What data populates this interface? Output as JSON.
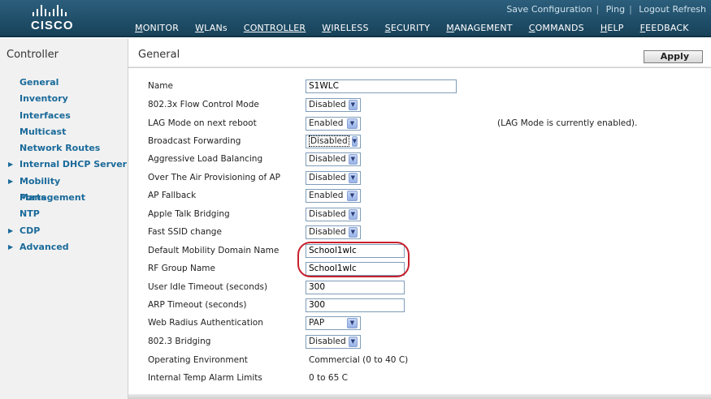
{
  "brand": {
    "name": "CISCO"
  },
  "utility_links": [
    "Save Configuration",
    "Ping",
    "Logout",
    "Refresh"
  ],
  "nav": [
    "MONITOR",
    "WLANs",
    "CONTROLLER",
    "WIRELESS",
    "SECURITY",
    "MANAGEMENT",
    "COMMANDS",
    "HELP",
    "FEEDBACK"
  ],
  "active_nav": "CONTROLLER",
  "sidebar": {
    "title": "Controller",
    "items": [
      {
        "label": "General",
        "expandable": false
      },
      {
        "label": "Inventory",
        "expandable": false
      },
      {
        "label": "Interfaces",
        "expandable": false
      },
      {
        "label": "Multicast",
        "expandable": false
      },
      {
        "label": "Network Routes",
        "expandable": false
      },
      {
        "label": "Internal DHCP Server",
        "expandable": true
      },
      {
        "label": "Mobility Management",
        "expandable": true
      },
      {
        "label": "Ports",
        "expandable": false
      },
      {
        "label": "NTP",
        "expandable": false
      },
      {
        "label": "CDP",
        "expandable": true
      },
      {
        "label": "Advanced",
        "expandable": true
      }
    ]
  },
  "page": {
    "title": "General",
    "apply_label": "Apply"
  },
  "fields": {
    "name": {
      "label": "Name",
      "value": "S1WLC"
    },
    "flow_control": {
      "label": "802.3x Flow Control Mode",
      "value": "Disabled"
    },
    "lag_mode": {
      "label": "LAG Mode on next reboot",
      "value": "Enabled",
      "note": "(LAG Mode is currently enabled)."
    },
    "broadcast_forwarding": {
      "label": "Broadcast Forwarding",
      "value": "Disabled"
    },
    "aggressive_lb": {
      "label": "Aggressive Load Balancing",
      "value": "Disabled"
    },
    "ota_provisioning": {
      "label": "Over The Air Provisioning of AP",
      "value": "Disabled"
    },
    "ap_fallback": {
      "label": "AP Fallback",
      "value": "Enabled"
    },
    "apple_talk": {
      "label": "Apple Talk Bridging",
      "value": "Disabled"
    },
    "fast_ssid": {
      "label": "Fast SSID change",
      "value": "Disabled"
    },
    "mobility_domain": {
      "label": "Default Mobility Domain Name",
      "value": "School1wlc"
    },
    "rf_group": {
      "label": "RF Group Name",
      "value": "School1wlc"
    },
    "idle_timeout": {
      "label": "User Idle Timeout (seconds)",
      "value": "300"
    },
    "arp_timeout": {
      "label": "ARP Timeout (seconds)",
      "value": "300"
    },
    "web_radius": {
      "label": "Web Radius Authentication",
      "value": "PAP"
    },
    "bridging_8023": {
      "label": "802.3 Bridging",
      "value": "Disabled"
    },
    "operating_env": {
      "label": "Operating Environment",
      "value": "Commercial (0 to 40 C)"
    },
    "temp_alarm": {
      "label": "Internal Temp Alarm Limits",
      "value": "0 to 65 C"
    }
  },
  "colors": {
    "accent": "#1a6a9a",
    "topbar": "#1f4d68",
    "highlight": "#c8202d"
  }
}
